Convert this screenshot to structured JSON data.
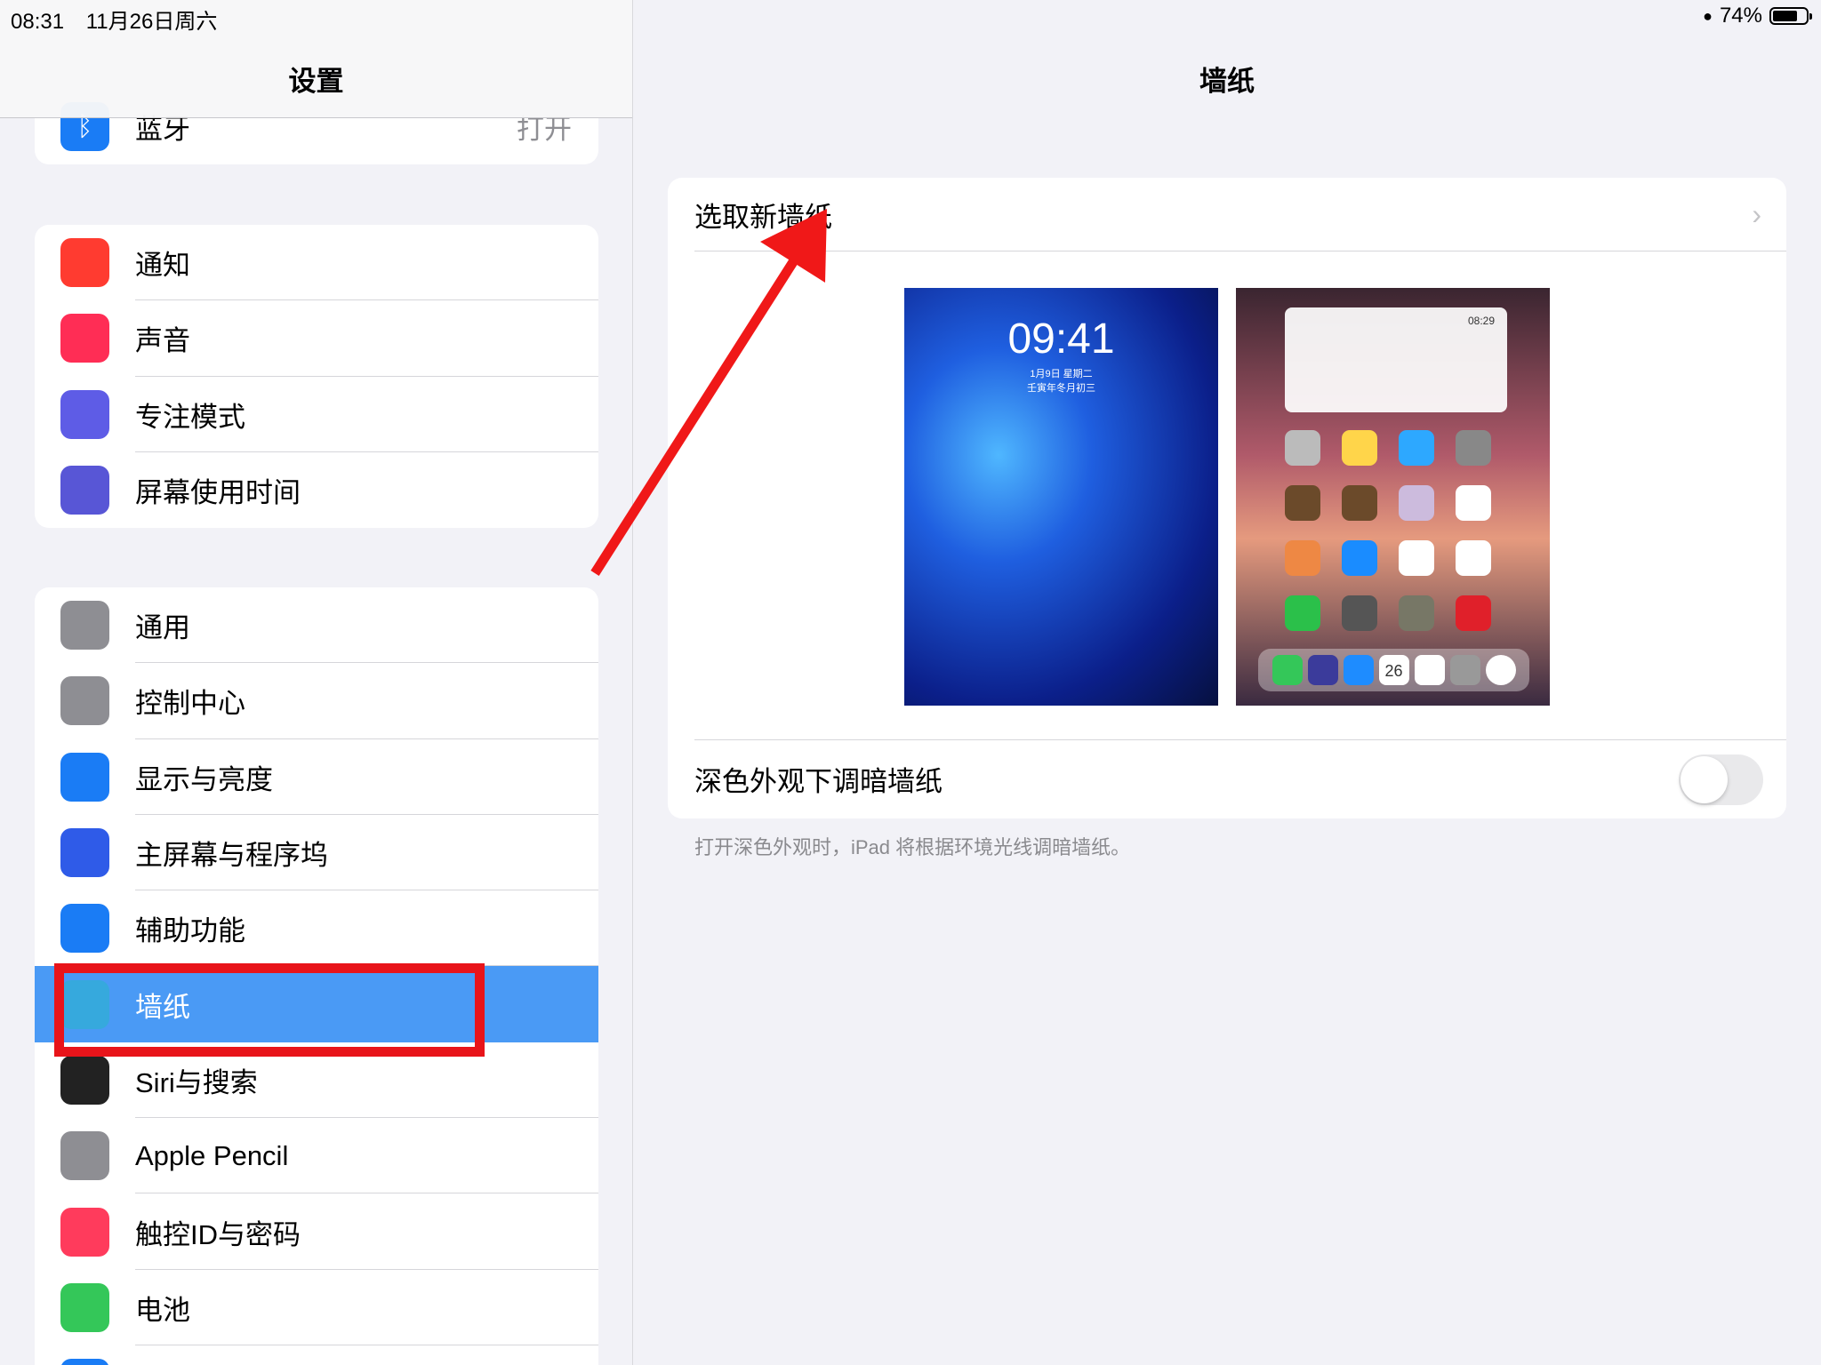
{
  "status_bar": {
    "time": "08:31",
    "date": "11月26日周六",
    "battery": "74%",
    "battery_level": 0.74
  },
  "sidebar": {
    "title": "设置",
    "bluetooth": {
      "label": "蓝牙",
      "value": "打开",
      "icon": "bluetooth-icon",
      "color": "#1a7cf5"
    },
    "group2": [
      {
        "label": "通知",
        "icon": "bell-icon",
        "color": "#ff3b30"
      },
      {
        "label": "声音",
        "icon": "speaker-icon",
        "color": "#ff2d55"
      },
      {
        "label": "专注模式",
        "icon": "moon-icon",
        "color": "#5e5ce6"
      },
      {
        "label": "屏幕使用时间",
        "icon": "hourglass-icon",
        "color": "#5856d6"
      }
    ],
    "group3": [
      {
        "label": "通用",
        "icon": "gear-icon",
        "color": "#8e8e93"
      },
      {
        "label": "控制中心",
        "icon": "switches-icon",
        "color": "#8e8e93"
      },
      {
        "label": "显示与亮度",
        "icon": "text-size-icon",
        "color": "#1a7cf5"
      },
      {
        "label": "主屏幕与程序坞",
        "icon": "app-grid-icon",
        "color": "#2f5be8"
      },
      {
        "label": "辅助功能",
        "icon": "accessibility-icon",
        "color": "#1a7cf5"
      },
      {
        "label": "墙纸",
        "icon": "flower-icon",
        "color": "#36a9dd",
        "selected": true
      },
      {
        "label": "Siri与搜索",
        "icon": "siri-icon",
        "color": "#222"
      },
      {
        "label": "Apple Pencil",
        "icon": "pencil-icon",
        "color": "#8e8e93"
      },
      {
        "label": "触控ID与密码",
        "icon": "fingerprint-icon",
        "color": "#ff3b5c"
      },
      {
        "label": "电池",
        "icon": "battery-icon",
        "color": "#34c759"
      },
      {
        "label": "",
        "icon": "hand-icon",
        "color": "#1a7cf5"
      }
    ]
  },
  "main": {
    "title": "墙纸",
    "choose_label": "选取新墙纸",
    "lock_preview": {
      "time": "09:41",
      "date": "1月9日 星期二",
      "lunar": "壬寅年冬月初三"
    },
    "home_preview": {
      "widget_time": "08:29",
      "calendar_day": "26"
    },
    "dim_label": "深色外观下调暗墙纸",
    "dim_enabled": false,
    "footer": "打开深色外观时，iPad 将根据环境光线调暗墙纸。"
  },
  "annotation": {
    "highlight_color": "#e8141a"
  }
}
